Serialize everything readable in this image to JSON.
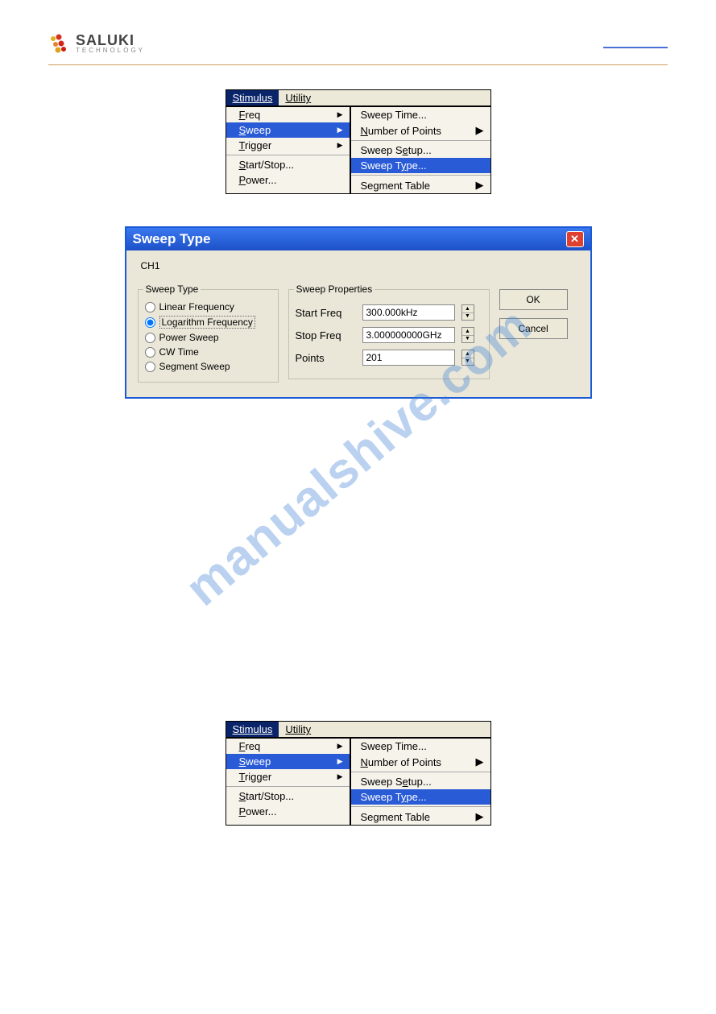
{
  "logo": {
    "name": "SALUKI",
    "sub": "TECHNOLOGY"
  },
  "menu": {
    "bar": {
      "stimulus": "Stimulus",
      "utility": "Utility"
    },
    "drop": {
      "freq": "Freq",
      "sweep": "Sweep",
      "trigger": "Trigger",
      "startstop": "Start/Stop...",
      "power": "Power..."
    },
    "sub": {
      "sweep_time": "Sweep Time...",
      "num_points": "Number of Points",
      "sweep_setup": "Sweep Setup...",
      "sweep_type": "Sweep Type...",
      "segment_table": "Segment Table"
    }
  },
  "dialog": {
    "title": "Sweep Type",
    "channel": "CH1",
    "group_type": "Sweep Type",
    "group_props": "Sweep Properties",
    "radios": {
      "linear": "Linear Frequency",
      "log": "Logarithm Frequency",
      "power": "Power Sweep",
      "cw": "CW Time",
      "segment": "Segment Sweep"
    },
    "props": {
      "start_label": "Start Freq",
      "start_value": "300.000kHz",
      "stop_label": "Stop Freq",
      "stop_value": "3.000000000GHz",
      "points_label": "Points",
      "points_value": "201"
    },
    "ok": "OK",
    "cancel": "Cancel"
  },
  "watermark": "manualshive.com"
}
